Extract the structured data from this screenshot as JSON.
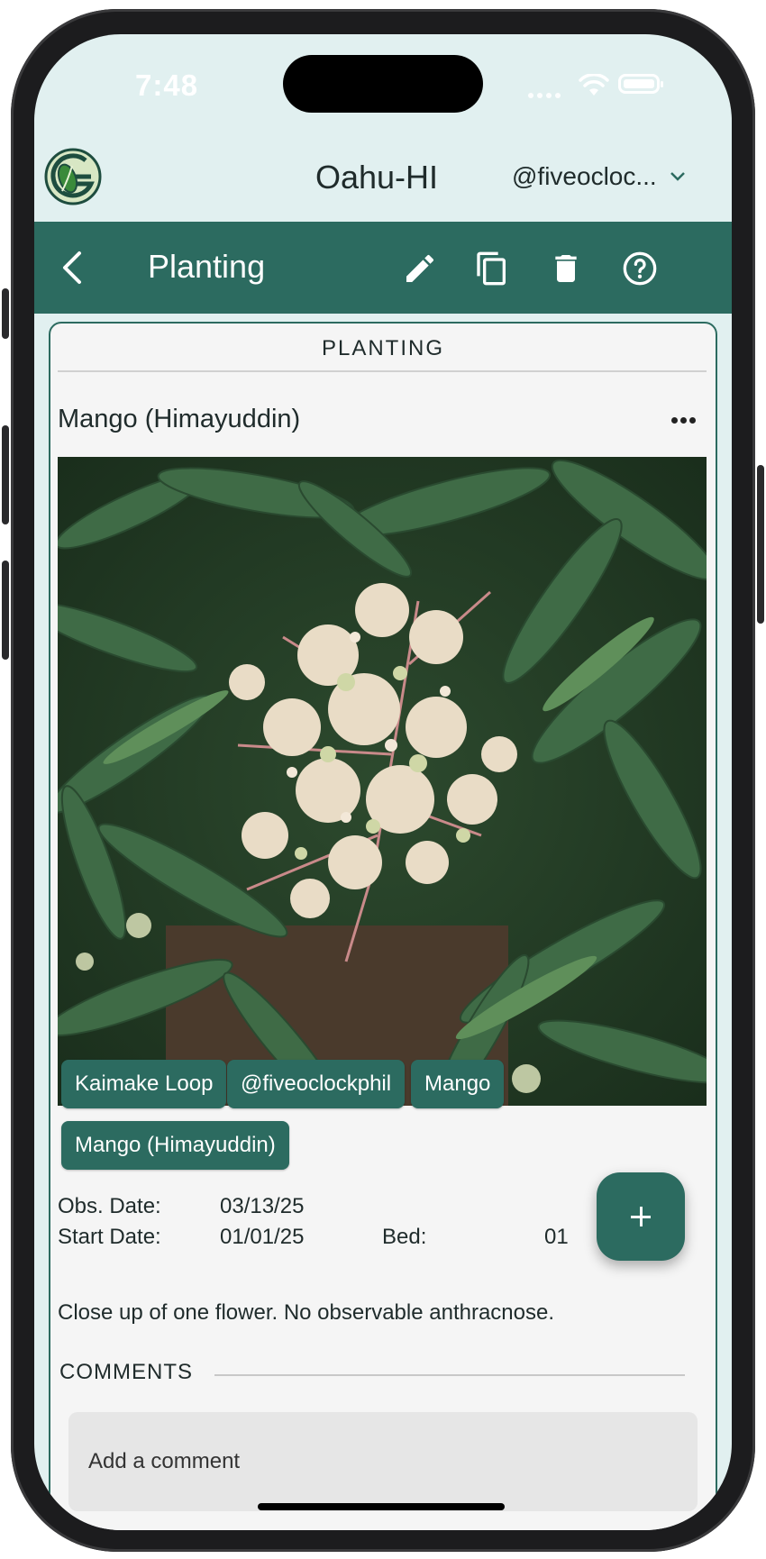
{
  "status_bar": {
    "time": "7:48"
  },
  "header": {
    "region": "Oahu-HI",
    "user": "@fiveocloc..."
  },
  "toolbar": {
    "title": "Planting"
  },
  "card": {
    "heading": "PLANTING",
    "plant_name": "Mango (Himayuddin)",
    "tags": [
      "Kaimake Loop",
      "@fiveoclockphil",
      "Mango",
      "Mango (Himayuddin)"
    ],
    "obs_date_label": "Obs. Date:",
    "obs_date": "03/13/25",
    "start_date_label": "Start Date:",
    "start_date": "01/01/25",
    "bed_label": "Bed:",
    "bed": "01",
    "notes": "Close up of one flower. No observable anthracnose.",
    "comments_label": "COMMENTS",
    "comment_placeholder": "Add a comment"
  },
  "colors": {
    "primary": "#2c6b60",
    "header_bg": "#e1f0f0",
    "card_bg": "#f5f5f5"
  },
  "icons": [
    "back-icon",
    "edit-icon",
    "copy-icon",
    "delete-icon",
    "help-icon",
    "more-icon",
    "add-icon",
    "chevron-down-icon",
    "wifi-icon",
    "battery-icon"
  ]
}
